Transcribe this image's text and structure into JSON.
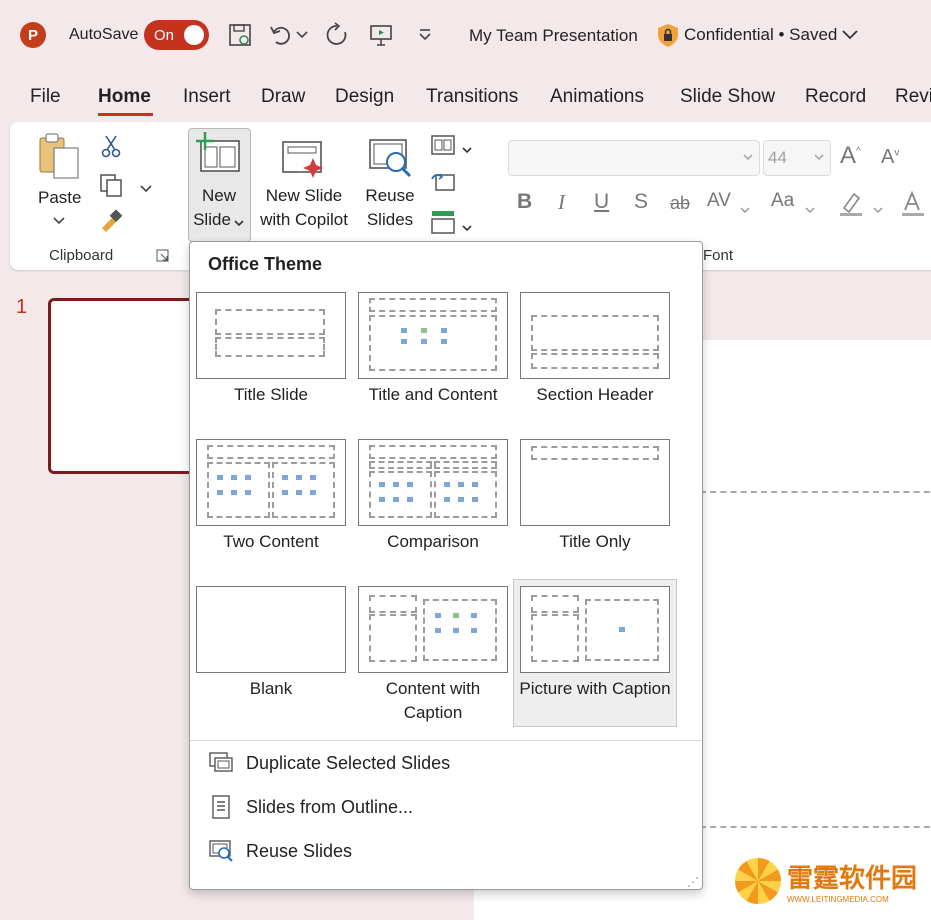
{
  "titlebar": {
    "app_logo": "P",
    "autosave_label": "AutoSave",
    "toggle_label": "On",
    "document_title": "My Team Presentation",
    "sensitivity": "Confidential • Saved"
  },
  "tabs": [
    "File",
    "Home",
    "Insert",
    "Draw",
    "Design",
    "Transitions",
    "Animations",
    "Slide Show",
    "Record",
    "Revi"
  ],
  "active_tab": "Home",
  "ribbon": {
    "paste_label": "Paste",
    "clipboard_group": "Clipboard",
    "new_slide_line1": "New",
    "new_slide_line2": "Slide",
    "copilot_line1": "New Slide",
    "copilot_line2": "with Copilot",
    "reuse_line1": "Reuse",
    "reuse_line2": "Slides",
    "font_size": "44",
    "font_group": "Font",
    "grow_font": "A",
    "shrink_font": "A",
    "bold": "B",
    "italic": "I",
    "underline": "U",
    "shadow": "S",
    "strike": "ab",
    "spacing": "AV",
    "change_case": "Aa"
  },
  "slides": {
    "number": "1"
  },
  "gallery": {
    "header": "Office Theme",
    "layouts": [
      {
        "caption": "Title Slide"
      },
      {
        "caption": "Title and Content"
      },
      {
        "caption": "Section Header"
      },
      {
        "caption": "Two Content"
      },
      {
        "caption": "Comparison"
      },
      {
        "caption": "Title Only"
      },
      {
        "caption": "Blank"
      },
      {
        "caption": "Content with Caption"
      },
      {
        "caption": "Picture with Caption"
      }
    ],
    "menu": [
      {
        "label": "Duplicate Selected Slides"
      },
      {
        "label": "Slides from Outline..."
      },
      {
        "label": "Reuse Slides"
      }
    ]
  },
  "watermark": {
    "text": "雷霆软件园",
    "url": "WWW.LEITINGMEDIA.COM"
  },
  "colors": {
    "accent": "#c4331e",
    "selection": "#7b1c1c"
  }
}
